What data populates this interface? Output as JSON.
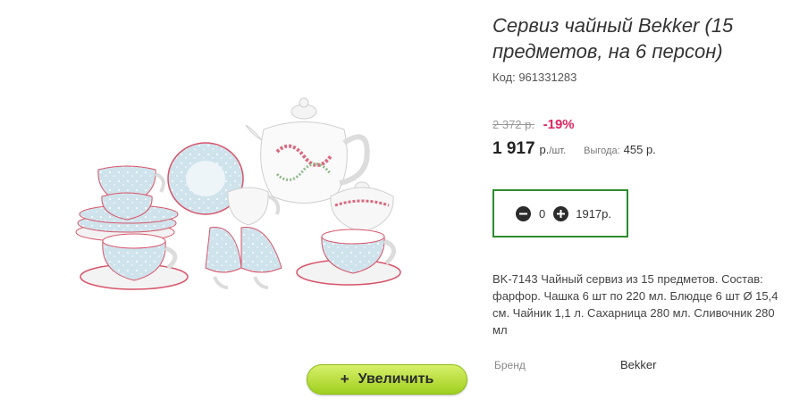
{
  "product": {
    "title": "Сервиз чайный Bekker (15 предметов, на 6 персон)",
    "code_label": "Код: 961331283",
    "old_price": "2 372 р.",
    "discount": "-19%",
    "price": "1 917",
    "price_unit": "р.",
    "price_per": "/шт.",
    "savings_label": "Выгода:",
    "savings_value": "455 р.",
    "description": "BK-7143 Чайный сервиз из 15 предметов. Состав: фарфор. Чашка 6 шт по 220 мл. Блюдце 6 шт Ø 15,4 см. Чайник 1,1 л. Сахарница 280 мл. Сливочник 280 мл",
    "brand_label": "Бренд",
    "brand_value": "Bekker"
  },
  "cart": {
    "quantity": "0",
    "total": "1917р."
  },
  "zoom_button": {
    "icon": "+",
    "label": "Увеличить"
  },
  "icons": {
    "minus": "minus-circle-icon",
    "plus": "plus-circle-icon"
  },
  "colors": {
    "accent_green": "#2e8b2e",
    "discount_red": "#e0245e",
    "button_green": "#9fcf1e"
  }
}
